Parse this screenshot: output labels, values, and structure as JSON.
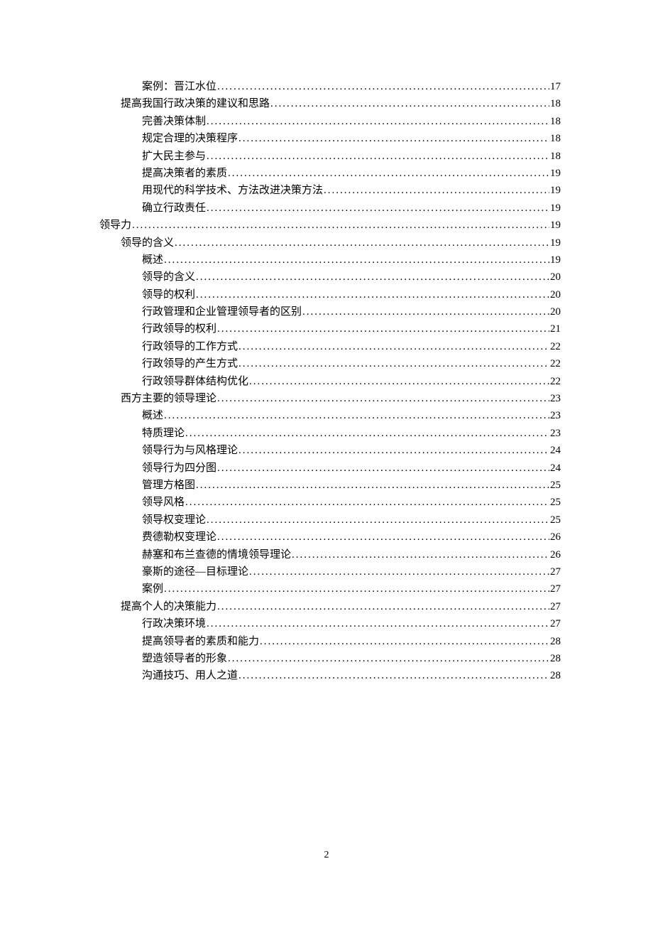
{
  "toc": [
    {
      "level": 2,
      "title": "案例：晋江水位",
      "page": "17"
    },
    {
      "level": 1,
      "title": "提高我国行政决策的建议和思路",
      "page": "18"
    },
    {
      "level": 2,
      "title": "完善决策体制",
      "page": "18"
    },
    {
      "level": 2,
      "title": "规定合理的决策程序",
      "page": "18"
    },
    {
      "level": 2,
      "title": "扩大民主参与",
      "page": "18"
    },
    {
      "level": 2,
      "title": "提高决策者的素质",
      "page": "19"
    },
    {
      "level": 2,
      "title": "用现代的科学技术、方法改进决策方法",
      "page": "19"
    },
    {
      "level": 2,
      "title": "确立行政责任",
      "page": "19"
    },
    {
      "level": 0,
      "title": "领导力",
      "page": "19"
    },
    {
      "level": 1,
      "title": "领导的含义",
      "page": "19"
    },
    {
      "level": 2,
      "title": "概述",
      "page": "19"
    },
    {
      "level": 2,
      "title": "领导的含义",
      "page": "20"
    },
    {
      "level": 2,
      "title": "领导的权利",
      "page": "20"
    },
    {
      "level": 2,
      "title": "行政管理和企业管理领导者的区别",
      "page": "20"
    },
    {
      "level": 2,
      "title": "行政领导的权利",
      "page": "21"
    },
    {
      "level": 2,
      "title": "行政领导的工作方式",
      "page": "22"
    },
    {
      "level": 2,
      "title": "行政领导的产生方式",
      "page": "22"
    },
    {
      "level": 2,
      "title": "行政领导群体结构优化",
      "page": "22"
    },
    {
      "level": 1,
      "title": "西方主要的领导理论",
      "page": "23"
    },
    {
      "level": 2,
      "title": "概述",
      "page": "23"
    },
    {
      "level": 2,
      "title": "特质理论",
      "page": "23"
    },
    {
      "level": 2,
      "title": "领导行为与风格理论",
      "page": "24"
    },
    {
      "level": 2,
      "title": "领导行为四分图",
      "page": "24"
    },
    {
      "level": 2,
      "title": "管理方格图",
      "page": "25"
    },
    {
      "level": 2,
      "title": "领导风格",
      "page": "25"
    },
    {
      "level": 2,
      "title": "领导权变理论",
      "page": "25"
    },
    {
      "level": 2,
      "title": "费德勒权变理论",
      "page": "26"
    },
    {
      "level": 2,
      "title": "赫塞和布兰查德的情境领导理论",
      "page": "26"
    },
    {
      "level": 2,
      "title": "豪斯的途径—目标理论",
      "page": "27"
    },
    {
      "level": 2,
      "title": "案例",
      "page": "27"
    },
    {
      "level": 1,
      "title": "提高个人的决策能力",
      "page": "27"
    },
    {
      "level": 2,
      "title": "行政决策环境",
      "page": "27"
    },
    {
      "level": 2,
      "title": "提高领导者的素质和能力",
      "page": "28"
    },
    {
      "level": 2,
      "title": "塑造领导者的形象",
      "page": "28"
    },
    {
      "level": 2,
      "title": "沟通技巧、用人之道",
      "page": "28"
    }
  ],
  "dots": "............................................................................................................................................",
  "pageNumber": "2"
}
